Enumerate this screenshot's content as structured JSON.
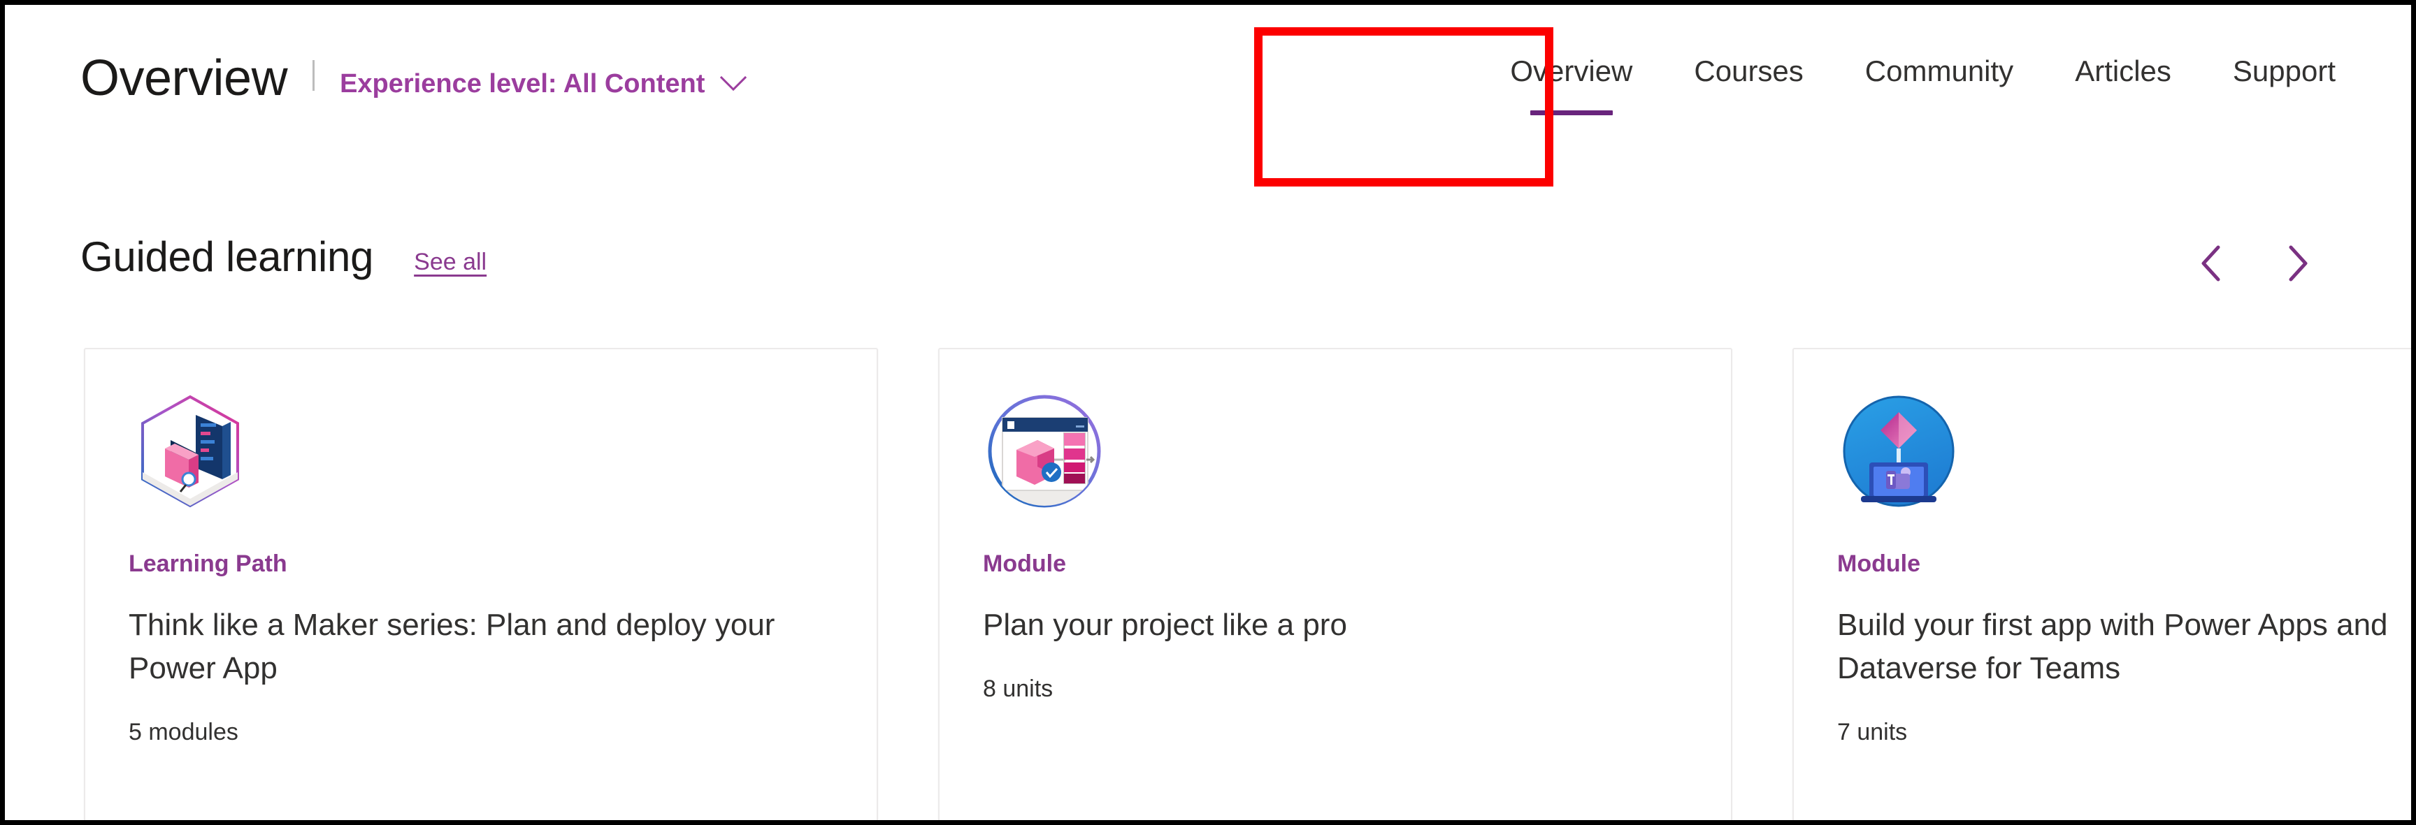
{
  "header": {
    "page_title": "Overview",
    "experience_filter_label": "Experience level: All Content",
    "chevron_icon": "chevron-down-icon"
  },
  "nav": {
    "items": [
      {
        "label": "Overview",
        "active": true
      },
      {
        "label": "Courses",
        "active": false
      },
      {
        "label": "Community",
        "active": false
      },
      {
        "label": "Articles",
        "active": false
      },
      {
        "label": "Support",
        "active": false
      }
    ],
    "active_underline_color": "#69247c",
    "highlight_color": "#fc0000"
  },
  "section": {
    "title": "Guided learning",
    "see_all_label": "See all",
    "prev_icon": "chevron-left-icon",
    "next_icon": "chevron-right-icon"
  },
  "cards": [
    {
      "badge_icon": "hexagon-learning-path-badge-icon",
      "kicker": "Learning Path",
      "title": "Think like a Maker series: Plan and deploy your Power App",
      "meta": "5 modules"
    },
    {
      "badge_icon": "circle-module-browser-badge-icon",
      "kicker": "Module",
      "title": "Plan your project like a pro",
      "meta": "8 units"
    },
    {
      "badge_icon": "circle-powerapps-teams-badge-icon",
      "kicker": "Module",
      "title": "Build your first app with Power Apps and\nDataverse for Teams",
      "meta": "7 units"
    }
  ],
  "colors": {
    "accent_purple": "#9b3d9e",
    "link_purple": "#8a3a8f",
    "underline_purple": "#69247c",
    "text_dark": "#323130",
    "title_dark": "#1b1a19",
    "card_border": "#eceaea",
    "annotation_red": "#fc0000"
  }
}
